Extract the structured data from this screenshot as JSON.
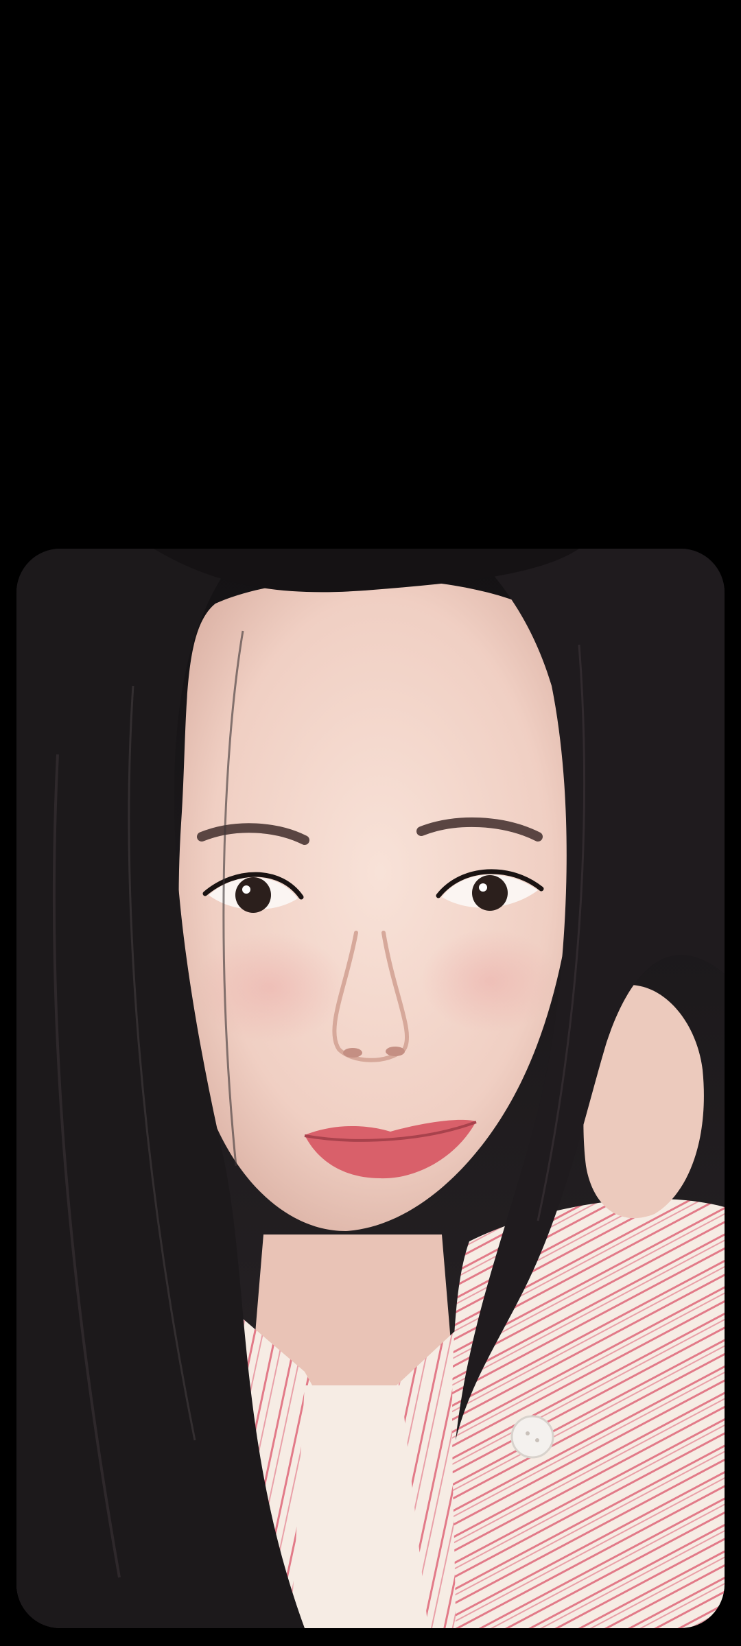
{
  "screen": {
    "background_color": "#000000"
  },
  "photo": {
    "subject": "selfie portrait",
    "colors": {
      "hair": "#1e1b1e",
      "skin": "#f1d3c8",
      "lips": "#d9606a",
      "shirt": "#f6ece4",
      "shirt_stripe": "#e27a88",
      "background_light": "#e8e6ee"
    }
  }
}
